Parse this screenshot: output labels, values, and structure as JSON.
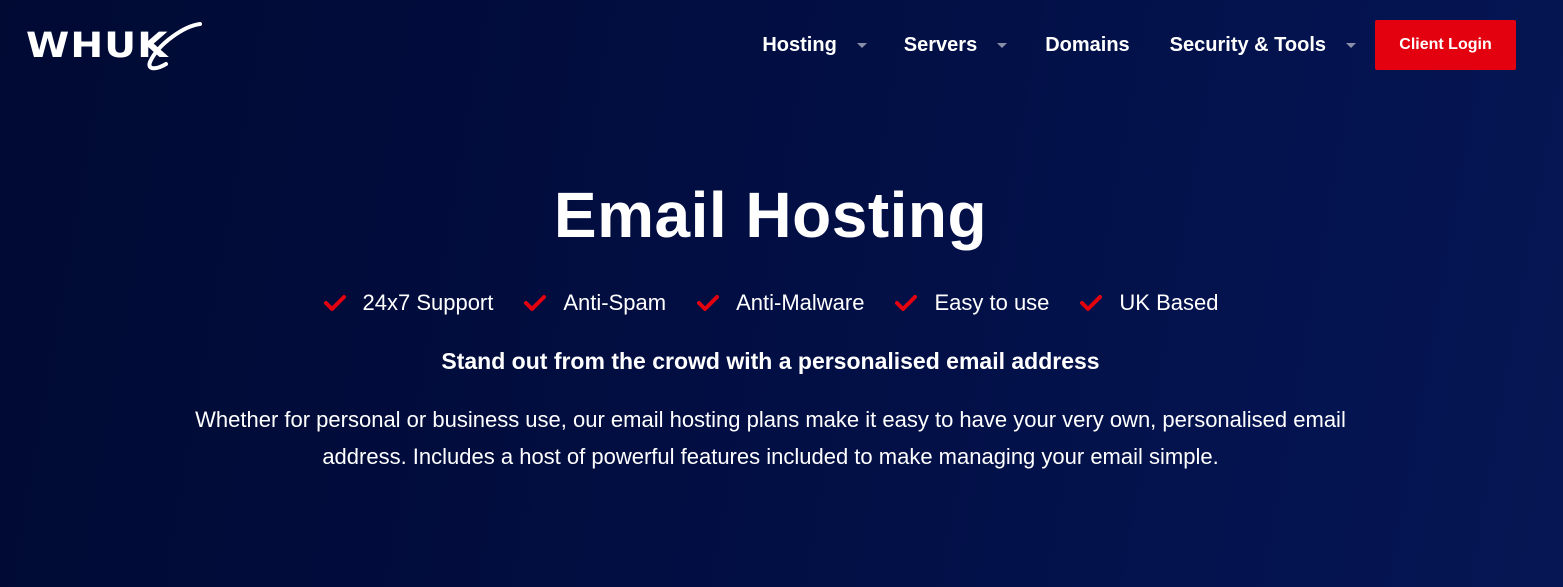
{
  "brand": {
    "logo_text": "WHUK",
    "accent_color": "#e3000f",
    "background_color": "#020e42"
  },
  "nav": {
    "items": [
      {
        "label": "Hosting",
        "has_dropdown": true
      },
      {
        "label": "Servers",
        "has_dropdown": true
      },
      {
        "label": "Domains",
        "has_dropdown": false
      },
      {
        "label": "Security & Tools",
        "has_dropdown": true
      }
    ],
    "login_label": "Client Login"
  },
  "hero": {
    "title": "Email Hosting",
    "features": [
      {
        "icon": "checkmark-icon",
        "label": "24x7 Support"
      },
      {
        "icon": "checkmark-icon",
        "label": "Anti-Spam"
      },
      {
        "icon": "checkmark-icon",
        "label": "Anti-Malware"
      },
      {
        "icon": "checkmark-icon",
        "label": "Easy to use"
      },
      {
        "icon": "checkmark-icon",
        "label": "UK Based"
      }
    ],
    "subtitle": "Stand out from the crowd with a personalised email address",
    "description": "Whether for personal or business use, our email hosting plans make it easy to have your very own, personalised email address. Includes a host of powerful features included to make managing your email simple."
  }
}
